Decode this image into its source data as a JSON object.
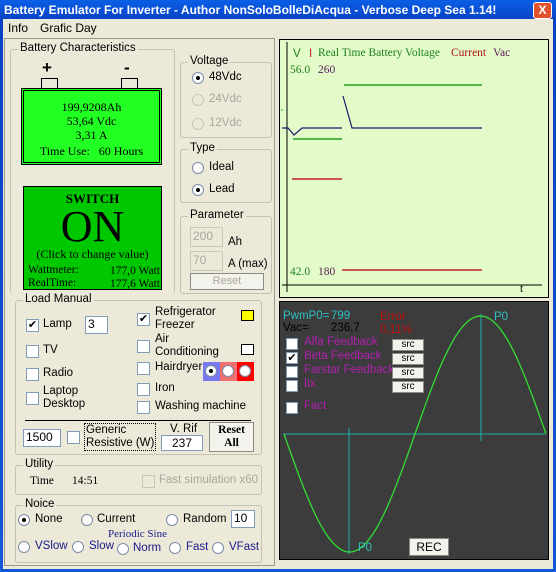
{
  "window": {
    "title": "Battery Emulator For Inverter - Author NonSoloBolleDiAcqua -  Verbose Deep Sea 1.14!",
    "close": "X"
  },
  "menu": [
    "Info",
    "Grafic Day"
  ],
  "battery": {
    "group": "Battery Characteristics",
    "plus": "+",
    "minus": "-",
    "ah": "199,9208Ah",
    "vdc": "53,64 Vdc",
    "amps": "3,31 A",
    "time_use_label": "Time Use:",
    "time_use_value": "60 Hours",
    "color": "#22ff22"
  },
  "switch": {
    "title": "SWITCH",
    "state": "ON",
    "hint": "(Click to change value)",
    "wattmeter_label": "Wattmeter:",
    "wattmeter_value": "177,0 Watt",
    "realtime_label": "RealTime:",
    "realtime_value": "177,6 Watt",
    "color": "#00c800"
  },
  "voltage": {
    "group": "Voltage",
    "options": [
      "48Vdc",
      "24Vdc",
      "12Vdc"
    ],
    "selected": "48Vdc"
  },
  "type": {
    "group": "Type",
    "options": [
      "Ideal",
      "Lead"
    ],
    "selected": "Lead"
  },
  "parameter": {
    "group": "Parameter",
    "ah_value": "200",
    "ah_unit": "Ah",
    "a_value": "70",
    "a_unit": "A (max)",
    "reset": "Reset"
  },
  "load": {
    "group": "Load Manual",
    "left": [
      {
        "label": "Lamp",
        "checked": true
      },
      {
        "label": "TV",
        "checked": false
      },
      {
        "label": "Radio",
        "checked": false
      },
      {
        "label": "Laptop\nDesktop",
        "checked": false
      }
    ],
    "lamp_count": "3",
    "right": [
      {
        "label": "Refrigerator\nFreezer",
        "checked": true
      },
      {
        "label": "Air\nConditioning",
        "checked": false
      },
      {
        "label": "Hairdryer",
        "checked": false
      },
      {
        "label": "Iron",
        "checked": false
      },
      {
        "label": "Washing machine",
        "checked": false
      }
    ],
    "generic_watts": "1500",
    "generic_label": "Generic\nResistive (W)",
    "vrif_label": "V. Rif",
    "vrif_value": "237",
    "reset_all": "Reset\nAll"
  },
  "utility": {
    "group": "Utility",
    "time_label": "Time",
    "time_value": "14:51",
    "fast_sim": "Fast simulation x60"
  },
  "noise": {
    "group": "Noice",
    "options": [
      "None",
      "Current",
      "Random"
    ],
    "selected": "None",
    "random_value": "10",
    "periodic_label": "Periodic Sine",
    "speeds": [
      "VSlow",
      "Slow",
      "Norm",
      "Fast",
      "VFast"
    ]
  },
  "voltage_chart": {
    "v_label": "V",
    "i_label": "I",
    "title": "Real Time Battery Voltage",
    "current_legend": "Current",
    "vac_legend": "Vac",
    "v_max": "56.0",
    "vac_max": "260",
    "v_min": "42.0",
    "vac_min": "180",
    "t_label": "t",
    "bg": "#e2fbc9"
  },
  "pwm": {
    "pwm_label": "PwmP0=",
    "pwm_value": "799",
    "vac_label": "Vac=",
    "vac_value": "236,7",
    "error_label": "Error",
    "error_value": "0,11%",
    "feedbacks": [
      {
        "label": "Alfa Feedback",
        "checked": false,
        "button": "src"
      },
      {
        "label": "Beta Feedback",
        "checked": true,
        "button": "src"
      },
      {
        "label": "Farstar Feedback",
        "checked": false,
        "button": "src"
      },
      {
        "label": "Iix",
        "checked": false,
        "button": "src"
      }
    ],
    "fact": "Fact",
    "p0_top": "P0",
    "p0_bottom": "P0",
    "rec": "REC",
    "bg": "#3c3c3c"
  }
}
